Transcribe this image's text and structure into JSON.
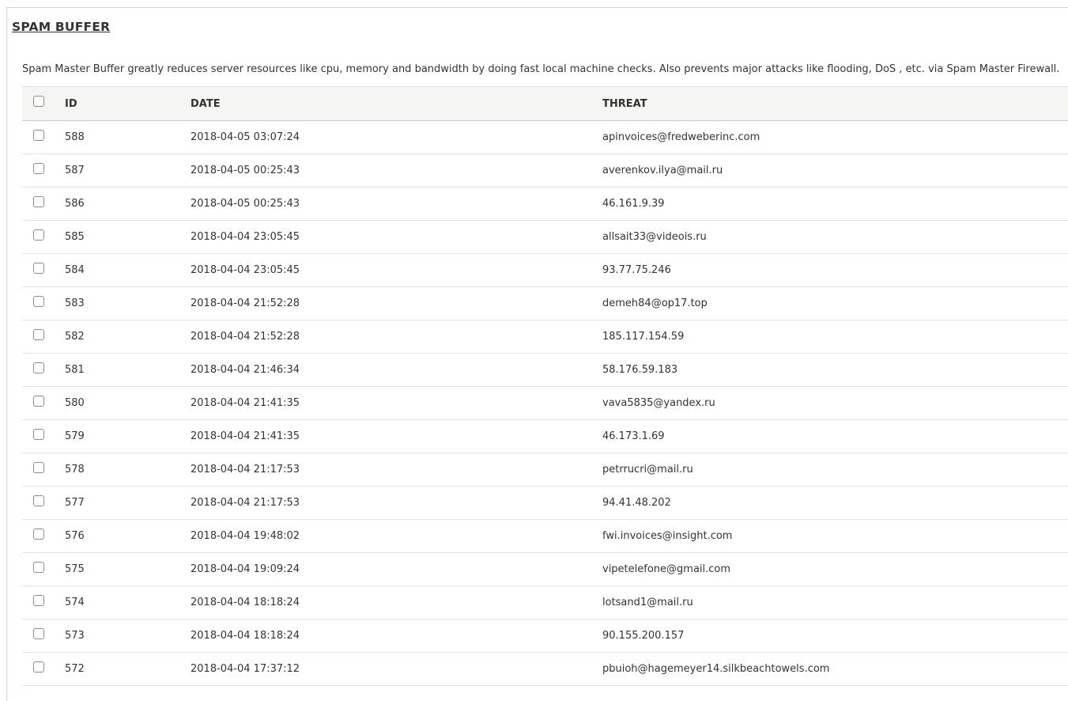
{
  "section": {
    "title": "SPAM BUFFER",
    "description": "Spam Master Buffer greatly reduces server resources like cpu, memory and bandwidth by doing fast local machine checks. Also prevents major attacks like flooding, DoS , etc. via Spam Master Firewall."
  },
  "table": {
    "headers": {
      "id": "ID",
      "date": "DATE",
      "threat": "THREAT"
    },
    "rows": [
      {
        "id": "588",
        "date": "2018-04-05 03:07:24",
        "threat": "apinvoices@fredweberinc.com"
      },
      {
        "id": "587",
        "date": "2018-04-05 00:25:43",
        "threat": "averenkov.ilya@mail.ru"
      },
      {
        "id": "586",
        "date": "2018-04-05 00:25:43",
        "threat": "46.161.9.39"
      },
      {
        "id": "585",
        "date": "2018-04-04 23:05:45",
        "threat": "allsait33@videois.ru"
      },
      {
        "id": "584",
        "date": "2018-04-04 23:05:45",
        "threat": "93.77.75.246"
      },
      {
        "id": "583",
        "date": "2018-04-04 21:52:28",
        "threat": "demeh84@op17.top"
      },
      {
        "id": "582",
        "date": "2018-04-04 21:52:28",
        "threat": "185.117.154.59"
      },
      {
        "id": "581",
        "date": "2018-04-04 21:46:34",
        "threat": "58.176.59.183"
      },
      {
        "id": "580",
        "date": "2018-04-04 21:41:35",
        "threat": "vava5835@yandex.ru"
      },
      {
        "id": "579",
        "date": "2018-04-04 21:41:35",
        "threat": "46.173.1.69"
      },
      {
        "id": "578",
        "date": "2018-04-04 21:17:53",
        "threat": "petrrucri@mail.ru"
      },
      {
        "id": "577",
        "date": "2018-04-04 21:17:53",
        "threat": "94.41.48.202"
      },
      {
        "id": "576",
        "date": "2018-04-04 19:48:02",
        "threat": "fwi.invoices@insight.com"
      },
      {
        "id": "575",
        "date": "2018-04-04 19:09:24",
        "threat": "vipetelefone@gmail.com"
      },
      {
        "id": "574",
        "date": "2018-04-04 18:18:24",
        "threat": "lotsand1@mail.ru"
      },
      {
        "id": "573",
        "date": "2018-04-04 18:18:24",
        "threat": "90.155.200.157"
      },
      {
        "id": "572",
        "date": "2018-04-04 17:37:12",
        "threat": "pbuioh@hagemeyer14.silkbeachtowels.com"
      }
    ]
  }
}
